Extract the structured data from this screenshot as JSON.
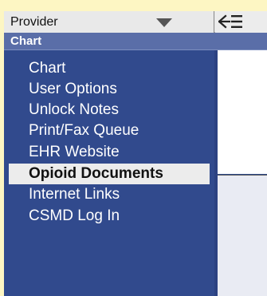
{
  "topbar": {
    "provider_label": "Provider",
    "caret_icon": "triangle-down-icon",
    "collapse_icon": "collapse-left-icon"
  },
  "section": {
    "title": "Chart"
  },
  "menu": {
    "items": [
      {
        "label": "Chart",
        "selected": false
      },
      {
        "label": "User Options",
        "selected": false
      },
      {
        "label": "Unlock Notes",
        "selected": false
      },
      {
        "label": "Print/Fax Queue",
        "selected": false
      },
      {
        "label": "EHR Website",
        "selected": false
      },
      {
        "label": "Opioid Documents",
        "selected": true
      },
      {
        "label": "Internet Links",
        "selected": false
      },
      {
        "label": "CSMD Log In",
        "selected": false
      }
    ]
  },
  "colors": {
    "page_background": "#fdf6c3",
    "sidebar": "#314a8d",
    "section_header": "#5a6ea8",
    "selected_item": "#ececec"
  }
}
